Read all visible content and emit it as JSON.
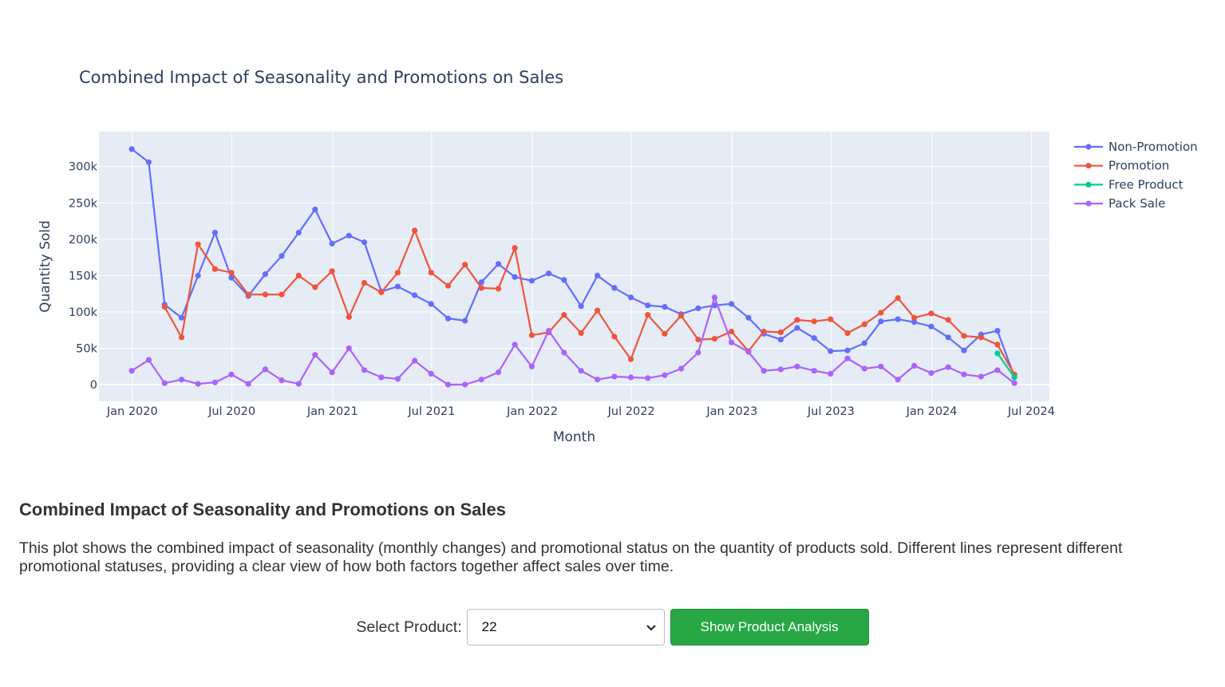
{
  "chart_data": {
    "type": "line",
    "title": "Combined Impact of Seasonality and Promotions on Sales",
    "xlabel": "Month",
    "ylabel": "Quantity Sold",
    "xlim": [
      "2019-11-01",
      "2024-08-03"
    ],
    "ylim": [
      -23000,
      348000
    ],
    "x_ticks": [
      "Jan 2020",
      "Jul 2020",
      "Jan 2021",
      "Jul 2021",
      "Jan 2022",
      "Jul 2022",
      "Jan 2023",
      "Jul 2023",
      "Jan 2024",
      "Jul 2024"
    ],
    "x_tick_dates": [
      "2020-01-01",
      "2020-07-01",
      "2021-01-01",
      "2021-07-01",
      "2022-01-01",
      "2022-07-01",
      "2023-01-01",
      "2023-07-01",
      "2024-01-01",
      "2024-07-01"
    ],
    "y_ticks": [
      0,
      50000,
      100000,
      150000,
      200000,
      250000,
      300000
    ],
    "y_tick_labels": [
      "0",
      "50k",
      "100k",
      "150k",
      "200k",
      "250k",
      "300k"
    ],
    "grid": true,
    "legend_position": "right",
    "x": [
      "2019-12-31",
      "2020-01-31",
      "2020-02-29",
      "2020-03-31",
      "2020-04-30",
      "2020-05-31",
      "2020-06-30",
      "2020-07-31",
      "2020-08-31",
      "2020-09-30",
      "2020-10-31",
      "2020-11-30",
      "2020-12-31",
      "2021-01-31",
      "2021-02-28",
      "2021-03-31",
      "2021-04-30",
      "2021-05-31",
      "2021-06-30",
      "2021-07-31",
      "2021-08-31",
      "2021-09-30",
      "2021-10-31",
      "2021-11-30",
      "2021-12-31",
      "2022-01-31",
      "2022-02-28",
      "2022-03-31",
      "2022-04-30",
      "2022-05-31",
      "2022-06-30",
      "2022-07-31",
      "2022-08-31",
      "2022-09-30",
      "2022-10-31",
      "2022-11-30",
      "2022-12-31",
      "2023-01-31",
      "2023-02-28",
      "2023-03-31",
      "2023-04-30",
      "2023-05-31",
      "2023-06-30",
      "2023-07-31",
      "2023-08-31",
      "2023-09-30",
      "2023-10-31",
      "2023-11-30",
      "2023-12-31",
      "2024-01-31",
      "2024-02-29",
      "2024-03-31",
      "2024-04-30",
      "2024-05-31",
      "2024-06-30"
    ],
    "series": [
      {
        "name": "Non-Promotion",
        "color": "#636efa",
        "values": [
          324000,
          306000,
          110000,
          92000,
          150000,
          209000,
          147000,
          122000,
          152000,
          177000,
          209000,
          241000,
          194000,
          205000,
          196000,
          128000,
          135000,
          123000,
          111000,
          91000,
          88000,
          141000,
          166000,
          148000,
          143000,
          153000,
          144000,
          108000,
          150000,
          133000,
          120000,
          109000,
          107000,
          97000,
          105000,
          109000,
          111000,
          92000,
          70000,
          62000,
          78000,
          64000,
          46000,
          47000,
          57000,
          87000,
          90000,
          86000,
          80000,
          65000,
          47000,
          69000,
          74000,
          11000
        ]
      },
      {
        "name": "Promotion",
        "color": "#ef553b",
        "values": [
          null,
          null,
          107000,
          65000,
          193000,
          159000,
          154000,
          124000,
          124000,
          124000,
          150000,
          134000,
          156000,
          93000,
          140000,
          127000,
          154000,
          212000,
          154000,
          136000,
          165000,
          133000,
          132000,
          188000,
          68000,
          72000,
          96000,
          71000,
          102000,
          66000,
          35000,
          96000,
          70000,
          95000,
          62000,
          63000,
          73000,
          46000,
          73000,
          72000,
          89000,
          87000,
          90000,
          71000,
          83000,
          99000,
          119000,
          92000,
          98000,
          89000,
          67000,
          65000,
          55000,
          14000
        ]
      },
      {
        "name": "Free Product",
        "color": "#00cc96",
        "values": [
          null,
          null,
          null,
          null,
          null,
          null,
          null,
          null,
          null,
          null,
          null,
          null,
          null,
          null,
          null,
          null,
          null,
          null,
          null,
          null,
          null,
          null,
          null,
          null,
          null,
          null,
          null,
          null,
          null,
          null,
          null,
          null,
          null,
          null,
          null,
          null,
          null,
          null,
          null,
          null,
          null,
          null,
          null,
          null,
          null,
          null,
          null,
          null,
          null,
          null,
          null,
          null,
          43000,
          10000
        ]
      },
      {
        "name": "Pack Sale",
        "color": "#ab63fa",
        "values": [
          19000,
          34000,
          2000,
          7000,
          1000,
          3000,
          14000,
          1000,
          21000,
          6000,
          1000,
          41000,
          17000,
          50000,
          20000,
          10000,
          8000,
          33000,
          15000,
          0,
          0,
          7000,
          17000,
          55000,
          25000,
          74000,
          44000,
          19000,
          7000,
          11000,
          10000,
          9000,
          13000,
          22000,
          44000,
          120000,
          58000,
          45000,
          19000,
          21000,
          25000,
          19000,
          15000,
          36000,
          22000,
          25000,
          7000,
          26000,
          16000,
          24000,
          14000,
          11000,
          20000,
          2000
        ]
      }
    ]
  },
  "description": {
    "title": "Combined Impact of Seasonality and Promotions on Sales",
    "text": "This plot shows the combined impact of seasonality (monthly changes) and promotional status on the quantity of products sold. Different lines represent different promotional statuses, providing a clear view of how both factors together affect sales over time."
  },
  "controls": {
    "select_label": "Select Product:",
    "select_value": "22",
    "button_label": "Show Product Analysis",
    "button_color": "#28a745"
  }
}
